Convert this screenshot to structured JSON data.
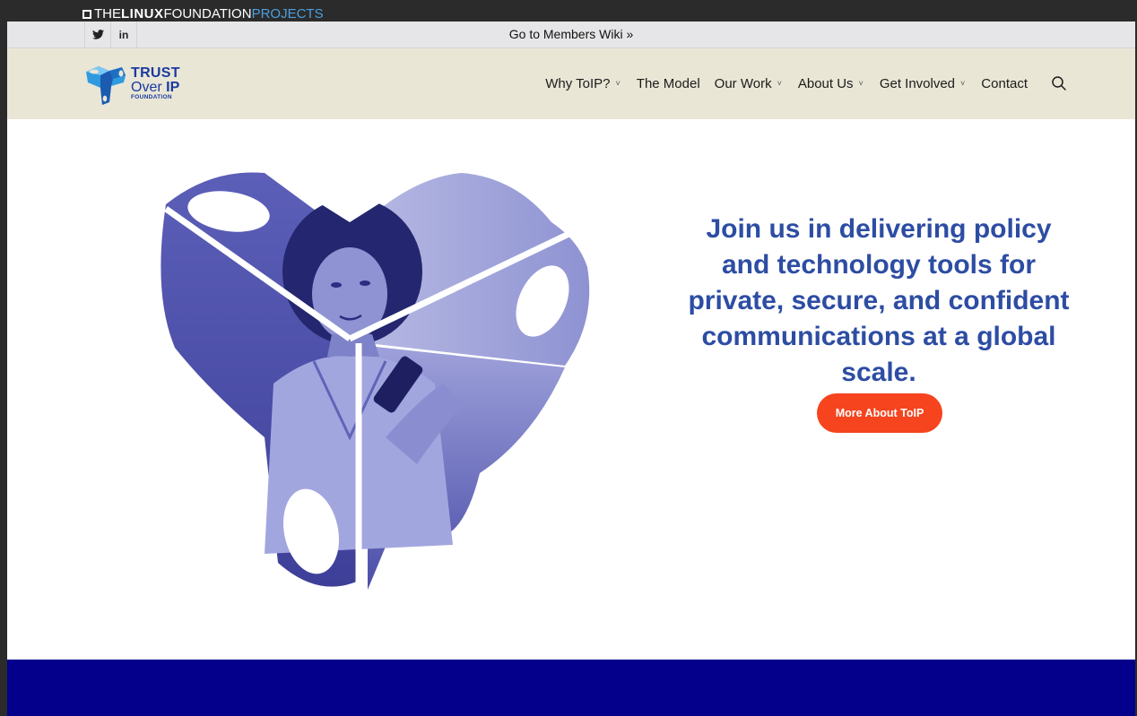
{
  "linux_foundation_bar": {
    "the": "THE",
    "linux": "LINUX",
    "foundation": "FOUNDATION",
    "projects": "PROJECTS"
  },
  "secondary_bar": {
    "social": [
      {
        "icon": "twitter-icon",
        "glyph": "🐦"
      },
      {
        "icon": "linkedin-icon",
        "glyph": "in"
      }
    ],
    "wiki_link": "Go to Members Wiki »"
  },
  "brand": {
    "line1": "TRUST",
    "line2_a": "Over ",
    "line2_b": "IP",
    "line3": "FOUNDATION"
  },
  "nav": {
    "items": [
      {
        "label": "Why ToIP?",
        "has_dropdown": true
      },
      {
        "label": "The Model",
        "has_dropdown": false
      },
      {
        "label": "Our Work",
        "has_dropdown": true
      },
      {
        "label": "About Us",
        "has_dropdown": true
      },
      {
        "label": "Get Involved",
        "has_dropdown": true
      },
      {
        "label": "Contact",
        "has_dropdown": false
      }
    ],
    "chevron": "˅",
    "search_icon": "search-icon"
  },
  "hero": {
    "headline": "Join us in delivering policy and technology tools for private, secure, and confident communications at a global scale.",
    "cta_label": "More About ToIP"
  },
  "colors": {
    "lf_bar": "#2b2b2b",
    "secondary_bar": "#e6e6e8",
    "nav_bg": "#e9e6d6",
    "headline": "#2d4da3",
    "cta": "#f5441e",
    "band": "#04008c"
  }
}
